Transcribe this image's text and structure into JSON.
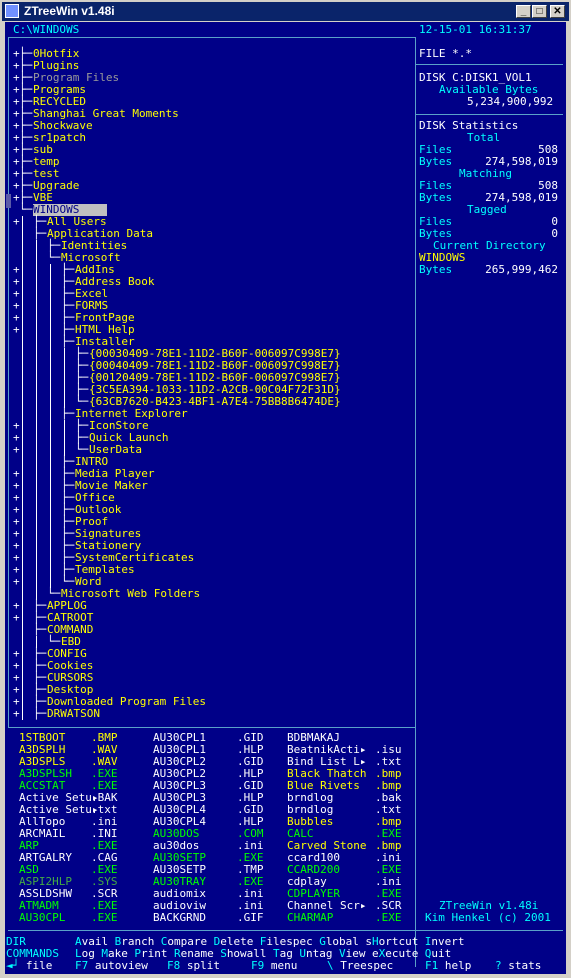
{
  "window": {
    "title": "ZTreeWin v1.48i"
  },
  "header": {
    "path": "C:\\WINDOWS",
    "datetime": "12-15-01 16:31:37"
  },
  "tree": [
    {
      "prefix": "+",
      "branch": "├─",
      "indent": 0,
      "name": "0Hotfix",
      "color": "y"
    },
    {
      "prefix": "+",
      "branch": "├─",
      "indent": 0,
      "name": "Plugins",
      "color": "y"
    },
    {
      "prefix": "+",
      "branch": "├─",
      "indent": 0,
      "name": "Program Files",
      "color": "dg"
    },
    {
      "prefix": "+",
      "branch": "├─",
      "indent": 0,
      "name": "Programs",
      "color": "y"
    },
    {
      "prefix": "+",
      "branch": "├─",
      "indent": 0,
      "name": "RECYCLED",
      "color": "y"
    },
    {
      "prefix": "+",
      "branch": "├─",
      "indent": 0,
      "name": "Shanghai Great Moments",
      "color": "y"
    },
    {
      "prefix": "+",
      "branch": "├─",
      "indent": 0,
      "name": "Shockwave",
      "color": "y"
    },
    {
      "prefix": "+",
      "branch": "├─",
      "indent": 0,
      "name": "sr1patch",
      "color": "y"
    },
    {
      "prefix": "+",
      "branch": "├─",
      "indent": 0,
      "name": "sub",
      "color": "y"
    },
    {
      "prefix": "+",
      "branch": "├─",
      "indent": 0,
      "name": "temp",
      "color": "y"
    },
    {
      "prefix": "+",
      "branch": "├─",
      "indent": 0,
      "name": "test",
      "color": "y"
    },
    {
      "prefix": "+",
      "branch": "├─",
      "indent": 0,
      "name": "Upgrade",
      "color": "y"
    },
    {
      "prefix": "+",
      "branch": "├─",
      "indent": 0,
      "name": "VBE",
      "color": "y"
    },
    {
      "prefix": "",
      "branch": "└─",
      "indent": 0,
      "name": "WINDOWS",
      "color": "hl"
    },
    {
      "prefix": "+",
      "branch": "├─",
      "indent": 1,
      "name": "All Users",
      "color": "y"
    },
    {
      "prefix": "",
      "branch": "├─",
      "indent": 1,
      "name": "Application Data",
      "color": "y"
    },
    {
      "prefix": "",
      "branch": "├─",
      "indent": 2,
      "name": "Identities",
      "color": "y"
    },
    {
      "prefix": "",
      "branch": "└─",
      "indent": 2,
      "name": "Microsoft",
      "color": "y"
    },
    {
      "prefix": "+",
      "branch": "├─",
      "indent": 3,
      "name": "AddIns",
      "color": "y"
    },
    {
      "prefix": "+",
      "branch": "├─",
      "indent": 3,
      "name": "Address Book",
      "color": "y"
    },
    {
      "prefix": "+",
      "branch": "├─",
      "indent": 3,
      "name": "Excel",
      "color": "y"
    },
    {
      "prefix": "+",
      "branch": "├─",
      "indent": 3,
      "name": "FORMS",
      "color": "y"
    },
    {
      "prefix": "+",
      "branch": "├─",
      "indent": 3,
      "name": "FrontPage",
      "color": "y"
    },
    {
      "prefix": "+",
      "branch": "├─",
      "indent": 3,
      "name": "HTML Help",
      "color": "y"
    },
    {
      "prefix": "",
      "branch": "├─",
      "indent": 3,
      "name": "Installer",
      "color": "y"
    },
    {
      "prefix": "",
      "branch": "├─",
      "indent": 4,
      "name": "{00030409-78E1-11D2-B60F-006097C998E7}",
      "color": "y"
    },
    {
      "prefix": "",
      "branch": "├─",
      "indent": 4,
      "name": "{00040409-78E1-11D2-B60F-006097C998E7}",
      "color": "y"
    },
    {
      "prefix": "",
      "branch": "├─",
      "indent": 4,
      "name": "{00120409-78E1-11D2-B60F-006097C998E7}",
      "color": "y"
    },
    {
      "prefix": "",
      "branch": "├─",
      "indent": 4,
      "name": "{3C5EA394-1033-11D2-A2CB-00C04F72F31D}",
      "color": "y"
    },
    {
      "prefix": "",
      "branch": "└─",
      "indent": 4,
      "name": "{63CB7620-B423-4BF1-A7E4-75BB8B6474DE}",
      "color": "y"
    },
    {
      "prefix": "",
      "branch": "├─",
      "indent": 3,
      "name": "Internet Explorer",
      "color": "y"
    },
    {
      "prefix": "+",
      "branch": "├─",
      "indent": 4,
      "name": "IconStore",
      "color": "y"
    },
    {
      "prefix": "+",
      "branch": "├─",
      "indent": 4,
      "name": "Quick Launch",
      "color": "y"
    },
    {
      "prefix": "+",
      "branch": "└─",
      "indent": 4,
      "name": "UserData",
      "color": "y"
    },
    {
      "prefix": "",
      "branch": "├─",
      "indent": 3,
      "name": "INTRO",
      "color": "y"
    },
    {
      "prefix": "+",
      "branch": "├─",
      "indent": 3,
      "name": "Media Player",
      "color": "y"
    },
    {
      "prefix": "+",
      "branch": "├─",
      "indent": 3,
      "name": "Movie Maker",
      "color": "y"
    },
    {
      "prefix": "+",
      "branch": "├─",
      "indent": 3,
      "name": "Office",
      "color": "y"
    },
    {
      "prefix": "+",
      "branch": "├─",
      "indent": 3,
      "name": "Outlook",
      "color": "y"
    },
    {
      "prefix": "+",
      "branch": "├─",
      "indent": 3,
      "name": "Proof",
      "color": "y"
    },
    {
      "prefix": "+",
      "branch": "├─",
      "indent": 3,
      "name": "Signatures",
      "color": "y"
    },
    {
      "prefix": "+",
      "branch": "├─",
      "indent": 3,
      "name": "Stationery",
      "color": "y"
    },
    {
      "prefix": "+",
      "branch": "├─",
      "indent": 3,
      "name": "SystemCertificates",
      "color": "y"
    },
    {
      "prefix": "+",
      "branch": "├─",
      "indent": 3,
      "name": "Templates",
      "color": "y"
    },
    {
      "prefix": "+",
      "branch": "└─",
      "indent": 3,
      "name": "Word",
      "color": "y"
    },
    {
      "prefix": "",
      "branch": "└─",
      "indent": 2,
      "name": "Microsoft Web Folders",
      "color": "y"
    },
    {
      "prefix": "+",
      "branch": "├─",
      "indent": 1,
      "name": "APPLOG",
      "color": "y"
    },
    {
      "prefix": "+",
      "branch": "├─",
      "indent": 1,
      "name": "CATROOT",
      "color": "y"
    },
    {
      "prefix": "",
      "branch": "├─",
      "indent": 1,
      "name": "COMMAND",
      "color": "y"
    },
    {
      "prefix": "",
      "branch": "└─",
      "indent": 2,
      "name": "EBD",
      "color": "y"
    },
    {
      "prefix": "+",
      "branch": "├─",
      "indent": 1,
      "name": "CONFIG",
      "color": "y"
    },
    {
      "prefix": "+",
      "branch": "├─",
      "indent": 1,
      "name": "Cookies",
      "color": "y"
    },
    {
      "prefix": "+",
      "branch": "├─",
      "indent": 1,
      "name": "CURSORS",
      "color": "y"
    },
    {
      "prefix": "+",
      "branch": "├─",
      "indent": 1,
      "name": "Desktop",
      "color": "y"
    },
    {
      "prefix": "+",
      "branch": "├─",
      "indent": 1,
      "name": "Downloaded Program Files",
      "color": "y"
    },
    {
      "prefix": "+",
      "branch": "├─",
      "indent": 1,
      "name": "DRWATSON",
      "color": "y"
    }
  ],
  "info": {
    "filespec": "FILE *.*",
    "disk_label": "DISK C:DISK1_VOL1",
    "available_label": "Available Bytes",
    "available_value": "5,234,900,992",
    "stats_title": "DISK Statistics",
    "total_label": "Total",
    "matching_label": "Matching",
    "tagged_label": "Tagged",
    "current_label": "Current Directory",
    "files_label": "Files",
    "bytes_label": "Bytes",
    "total_files": "508",
    "total_bytes": "274,598,019",
    "matching_files": "508",
    "matching_bytes": "274,598,019",
    "tagged_files": "0",
    "tagged_bytes": "0",
    "current_dir": "WINDOWS",
    "current_bytes": "265,999,462",
    "version": "ZTreeWin v1.48i",
    "author": "Kim Henkel (c) 2001"
  },
  "files": {
    "col1": [
      {
        "name": "1STBOOT",
        "ext": ".BMP",
        "color": "y"
      },
      {
        "name": "A3DSPLH",
        "ext": ".WAV",
        "color": "y"
      },
      {
        "name": "A3DSPLS",
        "ext": ".WAV",
        "color": "y"
      },
      {
        "name": "A3DSPLSH",
        "ext": ".EXE",
        "color": "g"
      },
      {
        "name": "ACCSTAT",
        "ext": ".EXE",
        "color": "g"
      },
      {
        "name": "Active Setu▸",
        "ext": ".BAK",
        "color": "w"
      },
      {
        "name": "Active Setu▸",
        "ext": ".txt",
        "color": "w"
      },
      {
        "name": "AllTopo",
        "ext": ".ini",
        "color": "w"
      },
      {
        "name": "ARCMAIL",
        "ext": ".INI",
        "color": "w"
      },
      {
        "name": "ARP",
        "ext": ".EXE",
        "color": "g"
      },
      {
        "name": "ARTGALRY",
        "ext": ".CAG",
        "color": "w"
      },
      {
        "name": "ASD",
        "ext": ".EXE",
        "color": "g"
      },
      {
        "name": "ASPI2HLP",
        "ext": ".SYS",
        "color": "dgn"
      },
      {
        "name": "ASSLDSHW",
        "ext": ".SCR",
        "color": "w"
      },
      {
        "name": "ATMADM",
        "ext": ".EXE",
        "color": "g"
      },
      {
        "name": "AU30CPL",
        "ext": ".EXE",
        "color": "g"
      }
    ],
    "col2": [
      {
        "name": "AU30CPL1",
        "ext": ".GID",
        "color": "w"
      },
      {
        "name": "AU30CPL1",
        "ext": ".HLP",
        "color": "w"
      },
      {
        "name": "AU30CPL2",
        "ext": ".GID",
        "color": "w"
      },
      {
        "name": "AU30CPL2",
        "ext": ".HLP",
        "color": "w"
      },
      {
        "name": "AU30CPL3",
        "ext": ".GID",
        "color": "w"
      },
      {
        "name": "AU30CPL3",
        "ext": ".HLP",
        "color": "w"
      },
      {
        "name": "AU30CPL4",
        "ext": ".GID",
        "color": "w"
      },
      {
        "name": "AU30CPL4",
        "ext": ".HLP",
        "color": "w"
      },
      {
        "name": "AU30DOS",
        "ext": ".COM",
        "color": "g"
      },
      {
        "name": "au30dos",
        "ext": ".ini",
        "color": "w"
      },
      {
        "name": "AU30SETP",
        "ext": ".EXE",
        "color": "g"
      },
      {
        "name": "AU30SETP",
        "ext": ".TMP",
        "color": "w"
      },
      {
        "name": "AU30TRAY",
        "ext": ".EXE",
        "color": "g"
      },
      {
        "name": "audiomix",
        "ext": ".ini",
        "color": "w"
      },
      {
        "name": "audioviw",
        "ext": ".ini",
        "color": "w"
      },
      {
        "name": "BACKGRND",
        "ext": ".GIF",
        "color": "w"
      }
    ],
    "col3": [
      {
        "name": "BDBMAKAJ",
        "ext": "",
        "color": "w"
      },
      {
        "name": "BeatnikActi▸",
        "ext": ".isu",
        "color": "w"
      },
      {
        "name": "Bind List L▸",
        "ext": ".txt",
        "color": "w"
      },
      {
        "name": "Black Thatch",
        "ext": ".bmp",
        "color": "y"
      },
      {
        "name": "Blue Rivets",
        "ext": ".bmp",
        "color": "y"
      },
      {
        "name": "brndlog",
        "ext": ".bak",
        "color": "w"
      },
      {
        "name": "brndlog",
        "ext": ".txt",
        "color": "w"
      },
      {
        "name": "Bubbles",
        "ext": ".bmp",
        "color": "y"
      },
      {
        "name": "CALC",
        "ext": ".EXE",
        "color": "g"
      },
      {
        "name": "Carved Stone",
        "ext": ".bmp",
        "color": "y"
      },
      {
        "name": "ccard100",
        "ext": ".ini",
        "color": "w"
      },
      {
        "name": "CCARD200",
        "ext": ".EXE",
        "color": "g"
      },
      {
        "name": "cdplay",
        "ext": ".ini",
        "color": "w"
      },
      {
        "name": "CDPLAYER",
        "ext": ".EXE",
        "color": "g"
      },
      {
        "name": "Channel Scr▸",
        "ext": ".SCR",
        "color": "w"
      },
      {
        "name": "CHARMAP",
        "ext": ".EXE",
        "color": "g"
      }
    ]
  },
  "menu": {
    "dir_label": "DIR",
    "commands_label": "COMMANDS",
    "row1": [
      {
        "hot": "A",
        "rest": "vail"
      },
      {
        "hot": "B",
        "rest": "ranch"
      },
      {
        "hot": "C",
        "rest": "ompare"
      },
      {
        "hot": "D",
        "rest": "elete"
      },
      {
        "hot": "F",
        "rest": "ilespec"
      },
      {
        "hot": "G",
        "rest": "lobal"
      },
      {
        "pre": "s",
        "hot": "H",
        "rest": "ortcut"
      },
      {
        "hot": "I",
        "rest": "nvert"
      }
    ],
    "row2": [
      {
        "hot": "L",
        "rest": "og"
      },
      {
        "hot": "M",
        "rest": "ake"
      },
      {
        "hot": "P",
        "rest": "rint"
      },
      {
        "hot": "R",
        "rest": "ename"
      },
      {
        "hot": "S",
        "rest": "howall"
      },
      {
        "hot": "T",
        "rest": "ag"
      },
      {
        "hot": "U",
        "rest": "ntag"
      },
      {
        "hot": "V",
        "rest": "iew"
      },
      {
        "pre": "e",
        "hot": "X",
        "rest": "ecute"
      },
      {
        "hot": "Q",
        "rest": "uit"
      }
    ],
    "row3": [
      {
        "key": "◄┘",
        "label": "file"
      },
      {
        "key": "F7",
        "label": "autoview"
      },
      {
        "key": "F8",
        "label": "split"
      },
      {
        "key": "F9",
        "label": "menu"
      },
      {
        "key": "\\",
        "label": "Treespec"
      },
      {
        "key": "F1",
        "label": "help"
      },
      {
        "key": "?",
        "label": "stats"
      }
    ]
  }
}
